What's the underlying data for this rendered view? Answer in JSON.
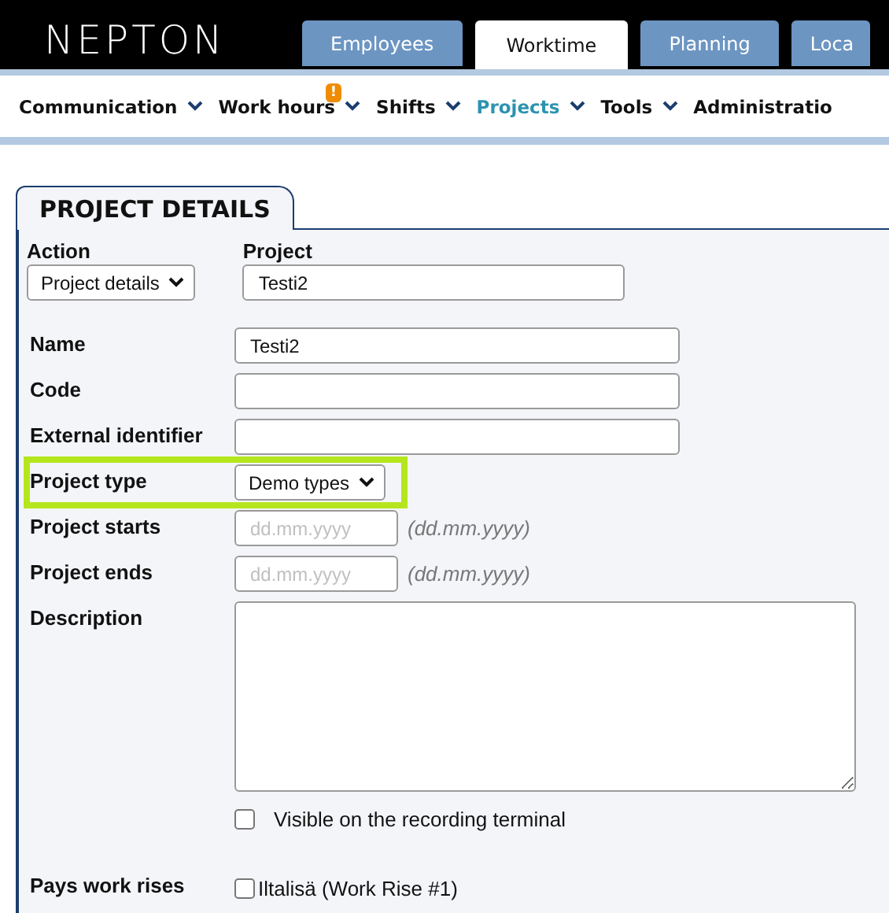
{
  "header": {
    "logo": "NEPTON",
    "tabs": [
      {
        "label": "Employees",
        "selected": false
      },
      {
        "label": "Worktime",
        "selected": true
      },
      {
        "label": "Planning",
        "selected": false
      },
      {
        "label": "Loca",
        "selected": false
      }
    ]
  },
  "nav": [
    {
      "label": "Communication",
      "selected": false
    },
    {
      "label": "Work hours",
      "selected": false,
      "badge": "!"
    },
    {
      "label": "Shifts",
      "selected": false
    },
    {
      "label": "Projects",
      "selected": true
    },
    {
      "label": "Tools",
      "selected": false
    },
    {
      "label": "Administratio",
      "selected": false
    }
  ],
  "panel": {
    "title": "PROJECT DETAILS",
    "action": {
      "label": "Action",
      "value": "Project details"
    },
    "project": {
      "label": "Project",
      "value": "Testi2"
    },
    "fields": [
      {
        "kind": "text",
        "label": "Name",
        "value": "Testi2",
        "highlighted": false
      },
      {
        "kind": "text",
        "label": "Code",
        "highlighted": false
      },
      {
        "kind": "text",
        "label": "External identifier",
        "highlighted": false
      },
      {
        "kind": "select",
        "label": "Project type",
        "value": "Demo types",
        "highlighted": true
      },
      {
        "kind": "date",
        "label": "Project starts",
        "placeholder": "dd.mm.yyyy",
        "hint": "(dd.mm.yyyy)",
        "highlighted": false
      },
      {
        "kind": "date",
        "label": "Project ends",
        "placeholder": "dd.mm.yyyy",
        "hint": "(dd.mm.yyyy)",
        "highlighted": false
      },
      {
        "kind": "textarea",
        "label": "Description",
        "highlighted": false
      }
    ],
    "visible_checkbox": {
      "label": "Visible on the recording terminal",
      "checked": false
    },
    "work_rises": {
      "label": "Pays work rises",
      "options": [
        {
          "label": "Iltalisä (Work Rise #1)",
          "checked": false
        }
      ]
    }
  }
}
